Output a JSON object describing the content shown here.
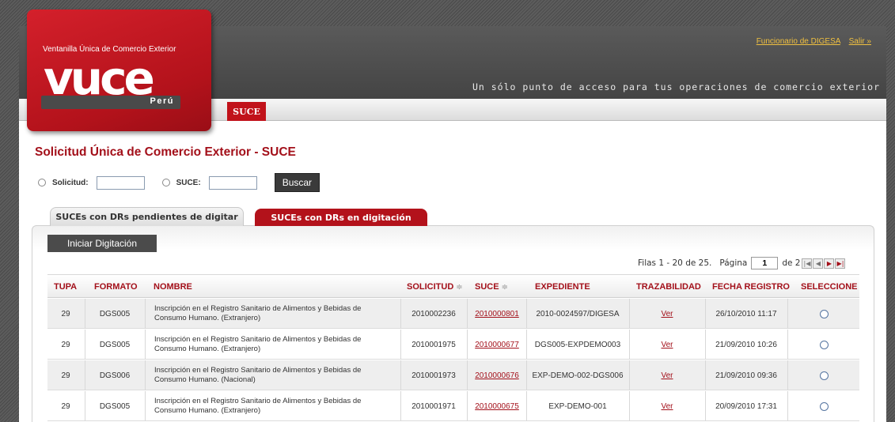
{
  "header": {
    "user_link": "Funcionario de DIGESA",
    "logout_link": "Salir »",
    "tagline": "Un sólo punto de acceso para tus operaciones de comercio exterior",
    "nav_tab": "SUCE"
  },
  "logo": {
    "top_text": "Ventanilla Única de Comercio Exterior",
    "word": "vuce",
    "country": "Perú"
  },
  "page": {
    "title": "Solicitud Única de Comercio Exterior - SUCE"
  },
  "search": {
    "solicitud_label": "Solicitud:",
    "suce_label": "SUCE:",
    "solicitud_value": "",
    "suce_value": "",
    "button": "Buscar"
  },
  "tabs": [
    {
      "label": "SUCEs con DRs pendientes de digitar",
      "active": false
    },
    {
      "label": "SUCEs con DRs en digitación",
      "active": true
    }
  ],
  "actions": {
    "iniciar": "Iniciar Digitación"
  },
  "pager": {
    "rows_text": "Filas 1 - 20 de 25.",
    "page_label": "Página",
    "page_value": "1",
    "of_text": "de 2"
  },
  "table": {
    "columns": [
      "TUPA",
      "FORMATO",
      "NOMBRE",
      "SOLICITUD",
      "SUCE",
      "EXPEDIENTE",
      "TRAZABILIDAD",
      "FECHA REGISTRO",
      "SELECCIONE"
    ],
    "sort_glyph": "≑",
    "rows": [
      {
        "tupa": "29",
        "formato": "DGS005",
        "nombre": "Inscripción en el Registro Sanitario de Alimentos y Bebidas de Consumo Humano. (Extranjero)",
        "solicitud": "2010002236",
        "suce": "2010000801",
        "expediente": "2010-0024597/DIGESA",
        "traz": "Ver",
        "fecha": "26/10/2010 11:17"
      },
      {
        "tupa": "29",
        "formato": "DGS005",
        "nombre": "Inscripción en el Registro Sanitario de Alimentos y Bebidas de Consumo Humano. (Extranjero)",
        "solicitud": "2010001975",
        "suce": "2010000677",
        "expediente": "DGS005-EXPDEMO003",
        "traz": "Ver",
        "fecha": "21/09/2010 10:26"
      },
      {
        "tupa": "29",
        "formato": "DGS006",
        "nombre": "Inscripción en el Registro Sanitario de Alimentos y Bebidas de Consumo Humano. (Nacional)",
        "solicitud": "2010001973",
        "suce": "2010000676",
        "expediente": "EXP-DEMO-002-DGS006",
        "traz": "Ver",
        "fecha": "21/09/2010 09:36"
      },
      {
        "tupa": "29",
        "formato": "DGS005",
        "nombre": "Inscripción en el Registro Sanitario de Alimentos y Bebidas de Consumo Humano. (Extranjero)",
        "solicitud": "2010001971",
        "suce": "2010000675",
        "expediente": "EXP-DEMO-001",
        "traz": "Ver",
        "fecha": "20/09/2010 17:31"
      }
    ]
  },
  "colors": {
    "brand_red": "#b3121b",
    "title_red": "#a3101a",
    "header_dark": "#4f4f4f"
  }
}
